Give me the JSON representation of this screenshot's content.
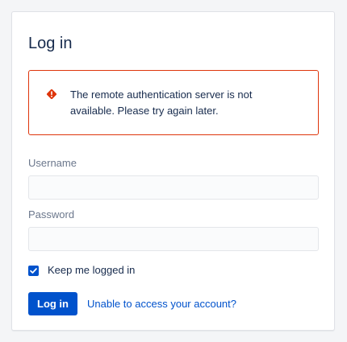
{
  "login": {
    "title": "Log in",
    "error": {
      "icon": "warning-diamond-icon",
      "message": "The remote authentication server is not available. Please try again later.",
      "color": "#de350b"
    },
    "username": {
      "label": "Username",
      "value": ""
    },
    "password": {
      "label": "Password",
      "value": ""
    },
    "keep_logged_in": {
      "label": "Keep me logged in",
      "checked": true
    },
    "submit_label": "Log in",
    "help_link": "Unable to access your account?",
    "accent_color": "#0052cc"
  }
}
